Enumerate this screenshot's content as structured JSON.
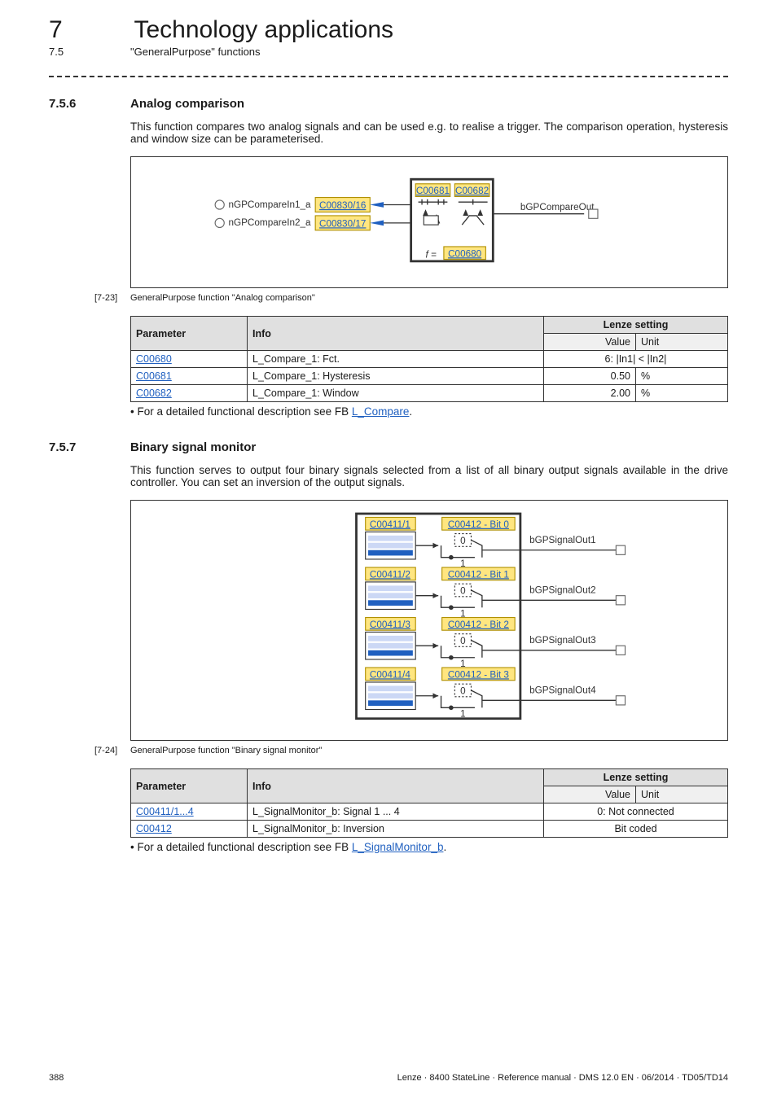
{
  "chapter": {
    "number": "7",
    "title": "Technology applications"
  },
  "section": {
    "number": "7.5",
    "title": "\"GeneralPurpose\" functions"
  },
  "sub1": {
    "number": "7.5.6",
    "title": "Analog comparison",
    "intro": "This function compares two analog signals and can be used e.g. to realise a trigger. The comparison operation, hysteresis and window size can be parameterised.",
    "diagram": {
      "in1": "nGPCompareIn1_a",
      "in2": "nGPCompareIn2_a",
      "port1": "C00830/16",
      "port2": "C00830/17",
      "p1": "C00681",
      "p2": "C00682",
      "f_lbl": "f =",
      "fcode": "C00680",
      "out": "bGPCompareOut"
    },
    "fig": {
      "num": "[7-23]",
      "text": "GeneralPurpose function \"Analog comparison\""
    },
    "table": {
      "h_param": "Parameter",
      "h_info": "Info",
      "h_setting": "Lenze setting",
      "h_value": "Value",
      "h_unit": "Unit",
      "rows": [
        {
          "param": "C00680",
          "info": "L_Compare_1: Fct.",
          "value": "6: |In1| < |In2|",
          "unit": "",
          "span": true
        },
        {
          "param": "C00681",
          "info": "L_Compare_1: Hysteresis",
          "value": "0.50",
          "unit": "%"
        },
        {
          "param": "C00682",
          "info": "L_Compare_1: Window",
          "value": "2.00",
          "unit": "%"
        }
      ]
    },
    "note": {
      "prefix": "• For a detailed functional description see FB ",
      "link": "L_Compare",
      "suffix": "."
    }
  },
  "sub2": {
    "number": "7.5.7",
    "title": "Binary signal monitor",
    "intro": "This function serves to output four binary signals selected from a list of all binary output signals available in the drive controller. You can set an inversion of the output signals.",
    "diagram": {
      "rows": [
        {
          "sel": "C00411/1",
          "bit": "C00412 - Bit 0",
          "out": "bGPSignalOut1"
        },
        {
          "sel": "C00411/2",
          "bit": "C00412 - Bit 1",
          "out": "bGPSignalOut2"
        },
        {
          "sel": "C00411/3",
          "bit": "C00412 - Bit 2",
          "out": "bGPSignalOut3"
        },
        {
          "sel": "C00411/4",
          "bit": "C00412 - Bit 3",
          "out": "bGPSignalOut4"
        }
      ],
      "zero": "0",
      "one": "1"
    },
    "fig": {
      "num": "[7-24]",
      "text": "GeneralPurpose function \"Binary signal monitor\""
    },
    "table": {
      "h_param": "Parameter",
      "h_info": "Info",
      "h_setting": "Lenze setting",
      "h_value": "Value",
      "h_unit": "Unit",
      "rows": [
        {
          "param": "C00411/1...4",
          "info": "L_SignalMonitor_b: Signal 1 ... 4",
          "value": "0: Not connected",
          "span": true
        },
        {
          "param": "C00412",
          "info": "L_SignalMonitor_b: Inversion",
          "value": "Bit coded",
          "span": true
        }
      ]
    },
    "note": {
      "prefix": "• For a detailed functional description see FB ",
      "link": "L_SignalMonitor_b",
      "suffix": "."
    }
  },
  "footer": {
    "page": "388",
    "meta": "Lenze · 8400 StateLine · Reference manual · DMS 12.0 EN · 06/2014 · TD05/TD14"
  }
}
